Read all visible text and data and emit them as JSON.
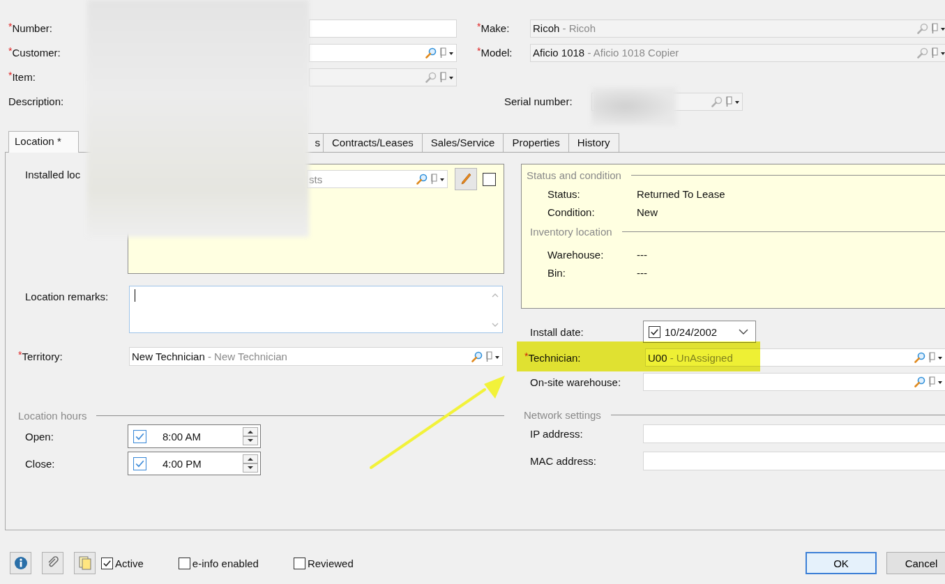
{
  "required_mark": "*",
  "header_left": [
    {
      "label": "Number:",
      "required": true,
      "kind": "text",
      "disabled": false
    },
    {
      "label": "Customer:",
      "required": true,
      "kind": "lookup",
      "disabled": false
    },
    {
      "label": "Item:",
      "required": true,
      "kind": "lookup",
      "disabled": true
    },
    {
      "label": "Description:",
      "required": false,
      "kind": "none"
    }
  ],
  "header_right": [
    {
      "label": "Make:",
      "required": true,
      "value": "Ricoh",
      "detail": "- Ricoh",
      "disabled": true
    },
    {
      "label": "Model:",
      "required": true,
      "value": "Aficio 1018",
      "detail": "- Aficio 1018 Copier",
      "disabled": true
    }
  ],
  "serial": {
    "label": "Serial number:",
    "disabled": true
  },
  "tabs": [
    {
      "label": "Location *",
      "selected": true,
      "kind": "full"
    },
    {
      "label": "s",
      "selected": false,
      "kind": "covered"
    },
    {
      "label": "Contracts/Leases",
      "selected": false,
      "kind": "full"
    },
    {
      "label": "Sales/Service",
      "selected": false,
      "kind": "full"
    },
    {
      "label": "Properties",
      "selected": false,
      "kind": "full"
    },
    {
      "label": "History",
      "selected": false,
      "kind": "full"
    }
  ],
  "installed": {
    "label": "Installed loc",
    "placeholder": "sts",
    "checked": false
  },
  "remarks": {
    "label": "Location remarks:"
  },
  "territory": {
    "label": "Territory:",
    "required": true,
    "value": "New Technician",
    "detail": "- New Technician"
  },
  "hours": {
    "title": "Location hours",
    "rows": [
      {
        "label": "Open:",
        "checked": true,
        "value": "8:00 AM"
      },
      {
        "label": "Close:",
        "checked": true,
        "value": "4:00 PM"
      }
    ]
  },
  "status_box": {
    "title": "Status and condition",
    "rows": [
      {
        "label": "Status:",
        "value": "Returned To Lease"
      },
      {
        "label": "Condition:",
        "value": "New"
      }
    ]
  },
  "inventory": {
    "title": "Inventory location",
    "rows": [
      {
        "label": "Warehouse:",
        "value": "---"
      },
      {
        "label": "Bin:",
        "value": "---"
      }
    ]
  },
  "install_date": {
    "label": "Install date:",
    "checked": true,
    "value": "10/24/2002"
  },
  "technician": {
    "label": "Technician:",
    "required": true,
    "value": "U00",
    "detail": "- UnAssigned",
    "highlighted": true
  },
  "onsite": {
    "label": "On-site warehouse:"
  },
  "network": {
    "title": "Network settings",
    "rows": [
      {
        "label": "IP address:"
      },
      {
        "label": "MAC address:"
      }
    ]
  },
  "footer": {
    "checks": [
      {
        "label": "Active",
        "checked": true
      },
      {
        "label": "e-info enabled",
        "checked": false
      },
      {
        "label": "Reviewed",
        "checked": false
      }
    ],
    "buttons": [
      {
        "label": "OK",
        "default": true
      },
      {
        "label": "Cancel",
        "default": false
      }
    ]
  }
}
